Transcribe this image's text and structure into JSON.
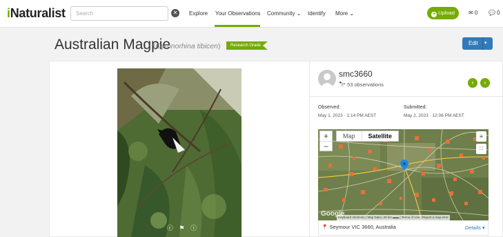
{
  "nav": {
    "logo_i": "i",
    "logo_rest": "Naturalist",
    "search_placeholder": "Search",
    "clear_glyph": "✕",
    "items": [
      "Explore",
      "Your Observations",
      "Community ⌄",
      "Identify",
      "More ⌄"
    ],
    "upload_plus": "+",
    "upload_label": "Upload",
    "messages": "✉ 0",
    "chat": "💬 0"
  },
  "header": {
    "title": "Australian Magpie",
    "scientific_name": "Gymnorhina tibicen",
    "badge": "Research Grade",
    "edit_label": "Edit",
    "edit_caret": "▾"
  },
  "photo": {
    "license_icons": "ⓒ ⚑ ⓘ"
  },
  "observer": {
    "username": "smc3660",
    "observations_icon": "🔭",
    "observations": "53 observations",
    "prev_glyph": "‹",
    "next_glyph": "›"
  },
  "meta": {
    "observed_label": "Observed:",
    "observed_value": "May 1, 2023 · 1:14 PM AEST",
    "submitted_label": "Submitted:",
    "submitted_value": "May 2, 2023 · 12:06 PM AEST"
  },
  "map": {
    "zoom_in": "+",
    "zoom_out": "−",
    "type_map": "Map",
    "type_satellite": "Satellite",
    "layers_glyph": "≡",
    "fullscreen_glyph": "⛶",
    "google": "Google",
    "attribution": "Keyboard shortcuts | Map Data | 20 km ▬▬ | Terms of Use | Report a map error",
    "place": "Seymour VIC 3660, Australia",
    "place_icon": "📍",
    "details": "Details ▾"
  },
  "colors": {
    "brand_green": "#74ac00",
    "link_blue": "#337ab7"
  }
}
